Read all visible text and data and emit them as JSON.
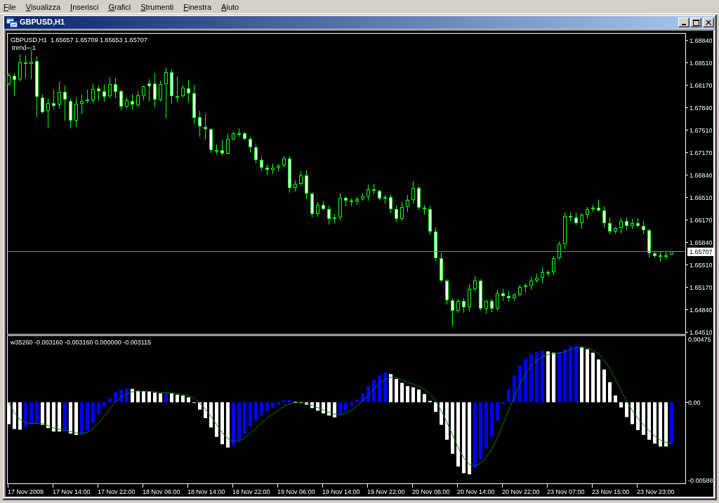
{
  "menu_bar": {
    "items": [
      "File",
      "Visualizza",
      "Inserisci",
      "Grafici",
      "Strumenti",
      "Finestra",
      "Aiuto"
    ]
  },
  "window": {
    "title": "GBPUSD,H1"
  },
  "price_chart": {
    "header": "GBPUSD,H1  1.65657 1.65709 1.65653 1.65707",
    "status": "trend=-1",
    "chart_data": {
      "type": "candlestick",
      "ylim": [
        1.6447,
        1.6894
      ],
      "yticks": [
        {
          "value": 1.6884,
          "label": "1.68840"
        },
        {
          "value": 1.6851,
          "label": "1.68510"
        },
        {
          "value": 1.6817,
          "label": "1.68170"
        },
        {
          "value": 1.6784,
          "label": "1.67840"
        },
        {
          "value": 1.6751,
          "label": "1.67510"
        },
        {
          "value": 1.6717,
          "label": "1.67170"
        },
        {
          "value": 1.6684,
          "label": "1.66840"
        },
        {
          "value": 1.6651,
          "label": "1.66510"
        },
        {
          "value": 1.6617,
          "label": "1.66170"
        },
        {
          "value": 1.6584,
          "label": "1.65840"
        },
        {
          "value": 1.6551,
          "label": "1.65510"
        },
        {
          "value": 1.6517,
          "label": "1.65170"
        },
        {
          "value": 1.6484,
          "label": "1.64840"
        },
        {
          "value": 1.6451,
          "label": "1.64510"
        }
      ],
      "ref_lines": [
        {
          "axis": "y",
          "value": 1.65707,
          "label": "1.65707",
          "color": "#778899"
        }
      ],
      "categories": [
        null,
        null,
        null,
        null,
        null,
        null,
        null,
        null,
        null,
        null,
        null,
        null,
        null,
        null,
        null,
        null,
        null,
        null,
        null,
        null,
        null,
        null,
        null,
        null,
        null,
        null,
        null,
        null,
        null,
        null,
        null,
        null,
        null,
        null,
        null,
        null,
        null,
        null,
        null,
        null,
        null,
        null,
        null,
        null,
        null,
        null,
        null,
        null,
        null,
        null,
        null,
        null,
        null,
        null,
        null,
        null,
        null,
        null,
        null,
        null,
        null,
        null,
        null,
        null,
        null,
        null,
        null,
        null,
        null,
        null,
        null,
        null,
        null,
        null,
        null,
        null,
        null,
        null,
        null,
        null,
        null,
        null,
        null,
        null,
        null,
        null,
        null,
        null,
        null,
        null,
        null,
        null,
        null,
        null,
        null,
        null,
        null,
        null,
        null,
        null,
        null,
        null,
        null,
        null,
        null,
        null,
        null,
        null,
        null,
        null,
        null,
        null,
        null,
        null,
        null,
        null,
        null,
        null,
        null
      ],
      "ohlc": [
        [
          1.6818,
          1.6835,
          1.6816,
          1.6832
        ],
        [
          1.6831,
          1.6834,
          1.6801,
          1.6825
        ],
        [
          1.6826,
          1.6863,
          1.6823,
          1.6851
        ],
        [
          1.6851,
          1.6861,
          1.6827,
          1.6851
        ],
        [
          1.6849,
          1.687,
          1.6826,
          1.6852
        ],
        [
          1.6853,
          1.686,
          1.677,
          1.68
        ],
        [
          1.6799,
          1.6804,
          1.6775,
          1.6777
        ],
        [
          1.6779,
          1.6797,
          1.6753,
          1.679
        ],
        [
          1.679,
          1.681,
          1.6782,
          1.6786
        ],
        [
          1.6788,
          1.6822,
          1.6782,
          1.6807
        ],
        [
          1.6807,
          1.6816,
          1.6764,
          1.6796
        ],
        [
          1.6793,
          1.6798,
          1.6753,
          1.6764
        ],
        [
          1.6764,
          1.6799,
          1.6755,
          1.6789
        ],
        [
          1.6789,
          1.6803,
          1.6774,
          1.6793
        ],
        [
          1.6796,
          1.681,
          1.679,
          1.6793
        ],
        [
          1.6794,
          1.6819,
          1.679,
          1.6811
        ],
        [
          1.6812,
          1.6816,
          1.6793,
          1.6808
        ],
        [
          1.6808,
          1.6818,
          1.6792,
          1.68
        ],
        [
          1.6801,
          1.6829,
          1.6798,
          1.6818
        ],
        [
          1.6818,
          1.6828,
          1.6798,
          1.6807
        ],
        [
          1.6808,
          1.681,
          1.678,
          1.6785
        ],
        [
          1.6785,
          1.6799,
          1.6783,
          1.6794
        ],
        [
          1.6793,
          1.6804,
          1.678,
          1.6788
        ],
        [
          1.6787,
          1.6808,
          1.6784,
          1.6802
        ],
        [
          1.6801,
          1.6816,
          1.6794,
          1.6815
        ],
        [
          1.6819,
          1.6826,
          1.6792,
          1.6815
        ],
        [
          1.6819,
          1.6835,
          1.6784,
          1.6796
        ],
        [
          1.6796,
          1.6824,
          1.6792,
          1.6818
        ],
        [
          1.6818,
          1.6843,
          1.6767,
          1.6836
        ],
        [
          1.6836,
          1.684,
          1.6789,
          1.6801
        ],
        [
          1.6801,
          1.683,
          1.6791,
          1.6801
        ],
        [
          1.6801,
          1.6817,
          1.6799,
          1.6813
        ],
        [
          1.6812,
          1.6825,
          1.6791,
          1.6805
        ],
        [
          1.6805,
          1.6817,
          1.676,
          1.6768
        ],
        [
          1.677,
          1.6779,
          1.674,
          1.6756
        ],
        [
          1.6755,
          1.6775,
          1.6736,
          1.6752
        ],
        [
          1.6752,
          1.6753,
          1.6716,
          1.672
        ],
        [
          1.672,
          1.6729,
          1.6714,
          1.672
        ],
        [
          1.672,
          1.6736,
          1.6712,
          1.6715
        ],
        [
          1.6715,
          1.6746,
          1.6714,
          1.6737
        ],
        [
          1.6736,
          1.6748,
          1.6735,
          1.6745
        ],
        [
          1.6745,
          1.6753,
          1.674,
          1.6746
        ],
        [
          1.6746,
          1.6748,
          1.6735,
          1.6737
        ],
        [
          1.6737,
          1.674,
          1.6717,
          1.6725
        ],
        [
          1.6725,
          1.6729,
          1.6701,
          1.6706
        ],
        [
          1.6706,
          1.6711,
          1.669,
          1.6694
        ],
        [
          1.6694,
          1.67,
          1.6683,
          1.6691
        ],
        [
          1.6691,
          1.6701,
          1.6685,
          1.6694
        ],
        [
          1.6694,
          1.67,
          1.6689,
          1.6698
        ],
        [
          1.6698,
          1.6711,
          1.6696,
          1.6708
        ],
        [
          1.6708,
          1.6712,
          1.6657,
          1.6664
        ],
        [
          1.6664,
          1.6676,
          1.6659,
          1.6671
        ],
        [
          1.6671,
          1.6689,
          1.6667,
          1.6683
        ],
        [
          1.6683,
          1.669,
          1.6648,
          1.6656
        ],
        [
          1.6656,
          1.6658,
          1.662,
          1.6626
        ],
        [
          1.6626,
          1.6643,
          1.6622,
          1.6639
        ],
        [
          1.6639,
          1.6644,
          1.6631,
          1.6633
        ],
        [
          1.6633,
          1.6638,
          1.661,
          1.6618
        ],
        [
          1.6618,
          1.6626,
          1.6612,
          1.662
        ],
        [
          1.662,
          1.6657,
          1.6616,
          1.665
        ],
        [
          1.665,
          1.6652,
          1.6637,
          1.6646
        ],
        [
          1.6646,
          1.6649,
          1.6637,
          1.6644
        ],
        [
          1.6644,
          1.6652,
          1.6639,
          1.6648
        ],
        [
          1.6648,
          1.6657,
          1.6646,
          1.6652
        ],
        [
          1.6652,
          1.6669,
          1.6645,
          1.6662
        ],
        [
          1.6662,
          1.667,
          1.6655,
          1.666
        ],
        [
          1.666,
          1.6662,
          1.6646,
          1.6649
        ],
        [
          1.6649,
          1.6654,
          1.664,
          1.6651
        ],
        [
          1.6651,
          1.6655,
          1.6627,
          1.6633
        ],
        [
          1.6633,
          1.6638,
          1.6613,
          1.6618
        ],
        [
          1.6618,
          1.6643,
          1.6615,
          1.6636
        ],
        [
          1.6636,
          1.6654,
          1.6629,
          1.6647
        ],
        [
          1.6647,
          1.6675,
          1.6641,
          1.6664
        ],
        [
          1.6664,
          1.6667,
          1.6632,
          1.6635
        ],
        [
          1.6635,
          1.6639,
          1.6625,
          1.6633
        ],
        [
          1.6633,
          1.6638,
          1.6594,
          1.66
        ],
        [
          1.66,
          1.6606,
          1.6556,
          1.656
        ],
        [
          1.656,
          1.6568,
          1.6525,
          1.6527
        ],
        [
          1.6527,
          1.6529,
          1.6491,
          1.6498
        ],
        [
          1.6498,
          1.6501,
          1.6459,
          1.6482
        ],
        [
          1.6482,
          1.65,
          1.6479,
          1.6496
        ],
        [
          1.6496,
          1.6501,
          1.6479,
          1.6487
        ],
        [
          1.6487,
          1.6521,
          1.6481,
          1.6514
        ],
        [
          1.6514,
          1.6534,
          1.651,
          1.6527
        ],
        [
          1.6527,
          1.6529,
          1.6483,
          1.6485
        ],
        [
          1.6485,
          1.6499,
          1.6478,
          1.6496
        ],
        [
          1.6496,
          1.65,
          1.648,
          1.6485
        ],
        [
          1.6485,
          1.6513,
          1.6482,
          1.6508
        ],
        [
          1.6508,
          1.6514,
          1.6496,
          1.6504
        ],
        [
          1.6504,
          1.6511,
          1.6495,
          1.6501
        ],
        [
          1.6501,
          1.6508,
          1.6497,
          1.6506
        ],
        [
          1.6506,
          1.652,
          1.6504,
          1.6517
        ],
        [
          1.6517,
          1.6523,
          1.6509,
          1.6519
        ],
        [
          1.6519,
          1.6532,
          1.6513,
          1.6527
        ],
        [
          1.6527,
          1.6537,
          1.6524,
          1.6531
        ],
        [
          1.6531,
          1.6547,
          1.6523,
          1.6539
        ],
        [
          1.6539,
          1.6542,
          1.6533,
          1.6539
        ],
        [
          1.6539,
          1.6563,
          1.6535,
          1.656
        ],
        [
          1.656,
          1.6585,
          1.6558,
          1.6581
        ],
        [
          1.6581,
          1.6628,
          1.6574,
          1.6623
        ],
        [
          1.6623,
          1.6629,
          1.6615,
          1.6621
        ],
        [
          1.6621,
          1.6628,
          1.6609,
          1.6612
        ],
        [
          1.6612,
          1.6627,
          1.6604,
          1.6625
        ],
        [
          1.6625,
          1.6636,
          1.6619,
          1.6633
        ],
        [
          1.6633,
          1.6639,
          1.6629,
          1.6635
        ],
        [
          1.6635,
          1.6647,
          1.6629,
          1.6631
        ],
        [
          1.6631,
          1.6637,
          1.6605,
          1.6612
        ],
        [
          1.6612,
          1.662,
          1.6595,
          1.66
        ],
        [
          1.66,
          1.6607,
          1.6597,
          1.6605
        ],
        [
          1.6605,
          1.6619,
          1.6597,
          1.6615
        ],
        [
          1.6615,
          1.662,
          1.6602,
          1.6608
        ],
        [
          1.6608,
          1.6618,
          1.6604,
          1.6612
        ],
        [
          1.6612,
          1.6619,
          1.6606,
          1.6608
        ],
        [
          1.6608,
          1.6615,
          1.6595,
          1.6602
        ],
        [
          1.6602,
          1.6604,
          1.6561,
          1.6567
        ],
        [
          1.6567,
          1.657,
          1.656,
          1.6563
        ],
        [
          1.6563,
          1.6569,
          1.6555,
          1.6564
        ],
        [
          1.6564,
          1.657,
          1.6558,
          1.6564
        ],
        [
          1.65657,
          1.65709,
          1.65653,
          1.65707
        ]
      ]
    }
  },
  "indicator": {
    "header": "w35260 -0.003160 -0.003160 0.000000 -0.003115",
    "chart_data": {
      "type": "bar",
      "ylim": [
        -0.00617,
        0.00504
      ],
      "yticks": [
        {
          "value": 0.00475,
          "label": "0.00475"
        },
        {
          "value": 0,
          "label": "0.00"
        },
        {
          "value": -0.00588,
          "label": "-0.00588"
        }
      ],
      "categories": [
        null,
        null,
        null,
        "17 Nov 2009",
        null,
        null,
        null,
        null,
        null,
        null,
        null,
        "17 Nov 14:00",
        null,
        null,
        null,
        null,
        null,
        null,
        null,
        "17 Nov 22:00",
        null,
        null,
        null,
        null,
        null,
        null,
        null,
        "18 Nov 06:00",
        null,
        null,
        null,
        null,
        null,
        null,
        null,
        "18 Nov 14:00",
        null,
        null,
        null,
        null,
        null,
        null,
        null,
        "18 Nov 22:00",
        null,
        null,
        null,
        null,
        null,
        null,
        null,
        "19 Nov 06:00",
        null,
        null,
        null,
        null,
        null,
        null,
        null,
        "19 Nov 14:00",
        null,
        null,
        null,
        null,
        null,
        null,
        null,
        "19 Nov 22:00",
        null,
        null,
        null,
        null,
        null,
        null,
        null,
        "20 Nov 06:00",
        null,
        null,
        null,
        null,
        null,
        null,
        null,
        "20 Nov 14:00",
        null,
        null,
        null,
        null,
        null,
        null,
        null,
        "20 Nov 22:00",
        null,
        null,
        null,
        null,
        null,
        null,
        null,
        "23 Nov 07:00",
        null,
        null,
        null,
        null,
        null,
        null,
        null,
        "23 Nov 15:00",
        null,
        null,
        null,
        null,
        null,
        null,
        null,
        "23 Nov 23:00",
        null,
        null,
        null
      ],
      "series": [
        {
          "color": "#0000ff",
          "values": [
            null,
            null,
            null,
            -0.00191,
            -0.00166,
            -0.00157,
            null,
            null,
            null,
            null,
            -0.0022,
            null,
            null,
            -0.00242,
            -0.00216,
            -0.00157,
            -0.0009,
            -0.00034,
            0.0003,
            0.00075,
            0.00096,
            0.00106,
            null,
            null,
            null,
            null,
            null,
            null,
            0.00069,
            null,
            null,
            null,
            null,
            null,
            null,
            null,
            null,
            null,
            null,
            null,
            -0.0033,
            -0.00293,
            -0.00238,
            -0.00183,
            -0.00137,
            -0.00098,
            -0.00067,
            -0.00044,
            -0.00019,
            0.00015,
            0.00017,
            null,
            null,
            null,
            null,
            null,
            null,
            null,
            null,
            -0.00098,
            -0.00067,
            -0.00027,
            0.0002,
            0.00067,
            0.00122,
            0.00172,
            0.00203,
            0.00223,
            null,
            null,
            null,
            null,
            null,
            null,
            null,
            null,
            null,
            null,
            null,
            null,
            null,
            null,
            null,
            -0.00498,
            -0.00432,
            -0.00351,
            -0.00259,
            -0.0014,
            -0.00014,
            0.00101,
            0.00203,
            0.00277,
            0.00328,
            0.00365,
            0.00379,
            0.00389,
            null,
            null,
            0.00379,
            0.00399,
            0.00426,
            0.00429,
            null,
            null,
            null,
            null,
            null,
            null,
            null,
            null,
            null,
            null,
            null,
            null,
            null,
            null,
            null,
            null,
            -0.00316
          ]
        },
        {
          "color": "#ffffff",
          "values": [
            -0.00166,
            -0.00203,
            -0.00208,
            null,
            null,
            null,
            -0.00172,
            -0.00196,
            -0.00222,
            -0.00222,
            null,
            -0.00237,
            -0.00247,
            null,
            null,
            null,
            null,
            null,
            null,
            null,
            null,
            null,
            0.00101,
            0.00088,
            0.00085,
            0.00081,
            0.00073,
            0.00067,
            null,
            0.00067,
            0.00057,
            0.00051,
            0.00037,
            -5e-05,
            -0.00056,
            -0.0012,
            -0.00191,
            -0.00262,
            -0.00318,
            -0.00343,
            null,
            null,
            null,
            null,
            null,
            null,
            null,
            null,
            null,
            null,
            null,
            4e-05,
            -3e-05,
            -0.00019,
            -0.00044,
            -0.00064,
            -0.00085,
            -0.00101,
            -0.00115,
            null,
            null,
            null,
            null,
            null,
            null,
            null,
            null,
            null,
            0.00213,
            0.00177,
            0.00147,
            0.00122,
            0.00113,
            0.00096,
            0.00062,
            0.0001,
            -0.00073,
            -0.00171,
            -0.00284,
            -0.0039,
            -0.00487,
            -0.00537,
            -0.00546,
            null,
            null,
            null,
            null,
            null,
            null,
            null,
            null,
            null,
            null,
            null,
            null,
            null,
            0.00385,
            0.00375,
            null,
            null,
            null,
            null,
            0.00419,
            0.00401,
            0.00375,
            0.00324,
            0.00248,
            0.00152,
            0.00051,
            -0.00039,
            -0.00112,
            -0.00166,
            -0.00211,
            -0.00247,
            -0.00284,
            -0.00313,
            -0.00335,
            -0.00335,
            null
          ]
        },
        {
          "type": "line",
          "color": "#008000",
          "values": [
            0,
            -0.00081,
            -0.00132,
            -0.00156,
            -0.0016,
            -0.00159,
            -0.00164,
            -0.00177,
            -0.00195,
            -0.00206,
            -0.00212,
            -0.00222,
            -0.00232,
            -0.00236,
            -0.00228,
            -0.002,
            -0.00156,
            -0.00107,
            -0.00052,
            0,
            0.00038,
            0.00065,
            0.00079,
            0.00083,
            0.00084,
            0.00083,
            0.00079,
            0.00074,
            0.00072,
            0.0007,
            0.00065,
            0.00059,
            0.0005,
            0.00028,
            -6e-05,
            -0.00052,
            -0.00108,
            -0.0017,
            -0.00229,
            -0.00275,
            -0.00297,
            -0.00295,
            -0.00272,
            -0.00236,
            -0.00196,
            -0.00157,
            -0.00121,
            -0.0009,
            -0.00062,
            -0.00031,
            -0.00012,
            -6e-05,
            -5e-05,
            -0.00011,
            -0.00024,
            -0.0004,
            -0.00058,
            -0.00075,
            -0.00091,
            -0.00094,
            -0.00083,
            -0.00061,
            -0.00029,
            9e-05,
            0.00054,
            0.00101,
            0.00142,
            0.00174,
            0.0019,
            0.00185,
            0.0017,
            0.00151,
            0.00136,
            0.0012,
            0.00097,
            0.00062,
            8e-05,
            -0.00064,
            -0.00152,
            -0.00247,
            -0.00343,
            -0.00421,
            -0.00471,
            -0.00482,
            -0.00462,
            -0.00418,
            -0.00354,
            -0.00268,
            -0.00166,
            -0.00059,
            0.00046,
            0.00138,
            0.00214,
            0.00274,
            0.00316,
            0.00345,
            0.00361,
            0.00367,
            0.00372,
            0.00383,
            0.004,
            0.00412,
            0.00415,
            0.00409,
            0.00395,
            0.00367,
            0.00319,
            0.00252,
            0.00172,
            0.00088,
            8e-05,
            -0.00062,
            -0.00122,
            -0.00172,
            -0.00217,
            -0.00255,
            -0.00287,
            -0.00306,
            -0.003115
          ]
        }
      ]
    }
  }
}
